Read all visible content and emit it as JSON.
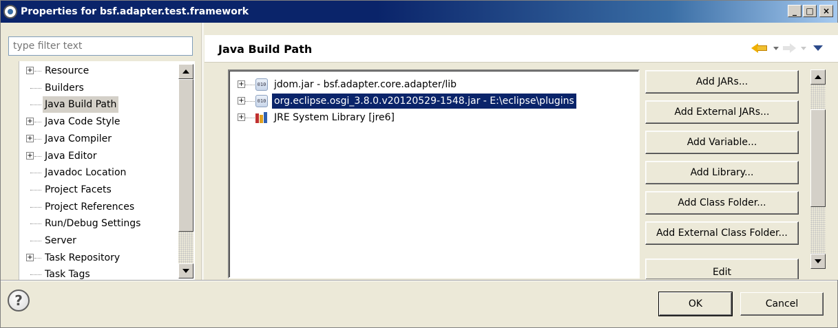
{
  "window": {
    "title": "Properties for bsf.adapter.test.framework",
    "buttons": {
      "minimize": "_",
      "maximize": "□",
      "close": "×"
    }
  },
  "filter": {
    "placeholder": "type filter text",
    "value": ""
  },
  "nav_tree": {
    "items": [
      {
        "label": "Resource",
        "expandable": true
      },
      {
        "label": "Builders",
        "expandable": false
      },
      {
        "label": "Java Build Path",
        "expandable": false,
        "selected": true
      },
      {
        "label": "Java Code Style",
        "expandable": true
      },
      {
        "label": "Java Compiler",
        "expandable": true
      },
      {
        "label": "Java Editor",
        "expandable": true
      },
      {
        "label": "Javadoc Location",
        "expandable": false
      },
      {
        "label": "Project Facets",
        "expandable": false
      },
      {
        "label": "Project References",
        "expandable": false
      },
      {
        "label": "Run/Debug Settings",
        "expandable": false
      },
      {
        "label": "Server",
        "expandable": false
      },
      {
        "label": "Task Repository",
        "expandable": true
      },
      {
        "label": "Task Tags",
        "expandable": false
      }
    ]
  },
  "page": {
    "title": "Java Build Path"
  },
  "libraries": [
    {
      "label": "jdom.jar - bsf.adapter.core.adapter/lib",
      "icon": "jar-icon",
      "jar_text": "010",
      "selected": false
    },
    {
      "label": "org.eclipse.osgi_3.8.0.v20120529-1548.jar - E:\\eclipse\\plugins",
      "icon": "jar-icon",
      "jar_text": "010",
      "selected": true
    },
    {
      "label": "JRE System Library [jre6]",
      "icon": "library-icon",
      "selected": false
    }
  ],
  "buttons": {
    "add_jars": "Add JARs...",
    "add_external_jars": "Add External JARs...",
    "add_variable": "Add Variable...",
    "add_library": "Add Library...",
    "add_class_folder": "Add Class Folder...",
    "add_external_class_folder": "Add External Class Folder...",
    "edit": "Edit"
  },
  "footer": {
    "help_glyph": "?",
    "ok": "OK",
    "cancel": "Cancel"
  },
  "colors": {
    "title_bar": "#0a246a",
    "selection": "#0a246a",
    "nav_selection": "#d4d0c8",
    "back_arrow": "#f0b000"
  }
}
